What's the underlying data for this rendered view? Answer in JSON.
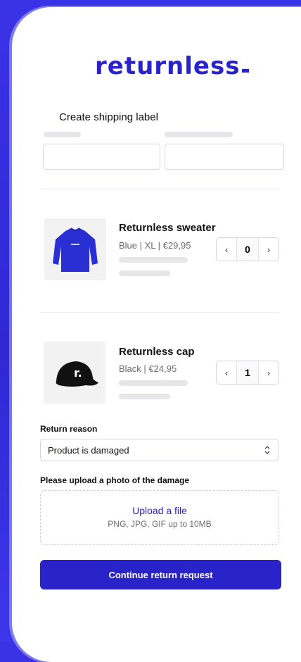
{
  "brand": {
    "logo_text": "returnless",
    "accent": "#2a23c9",
    "background": "#3a33e6"
  },
  "page": {
    "title": "Create shipping label"
  },
  "products": [
    {
      "name": "Returnless sweater",
      "color": "Blue",
      "size": "XL",
      "price": "€29,95",
      "quantity": "0",
      "image_icon": "blue-sweater-image"
    },
    {
      "name": "Returnless cap",
      "color": "Black",
      "price": "€24,95",
      "quantity": "1",
      "image_icon": "black-cap-image"
    }
  ],
  "return_reason": {
    "label": "Return reason",
    "selected": "Product is damaged"
  },
  "upload": {
    "label": "Please upload a photo of the damage",
    "link_text": "Upload a file",
    "hint": "PNG, JPG, GIF up to 10MB"
  },
  "actions": {
    "continue_label": "Continue return request"
  },
  "stepper": {
    "decrement_glyph": "‹",
    "increment_glyph": "›"
  }
}
